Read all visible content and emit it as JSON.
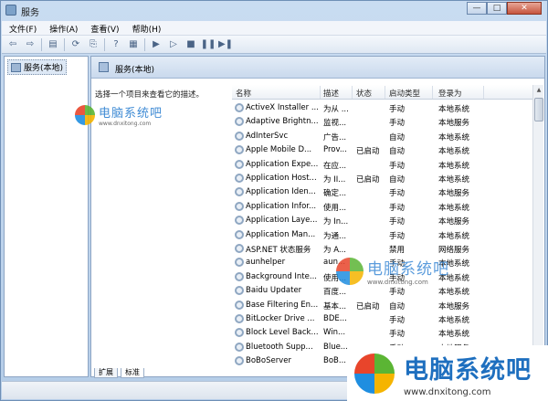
{
  "window": {
    "title": "服务",
    "minimize": "—",
    "maximize": "□",
    "close": "✕"
  },
  "menu": [
    "文件(F)",
    "操作(A)",
    "查看(V)",
    "帮助(H)"
  ],
  "tree": {
    "root_label": "服务(本地)"
  },
  "content": {
    "header_title": "服务(本地)",
    "description": "选择一个项目来查看它的描述。",
    "columns": [
      "名称",
      "描述",
      "状态",
      "启动类型",
      "登录为"
    ],
    "rows": [
      [
        "ActiveX Installer ...",
        "为从 ...",
        "",
        "手动",
        "本地系统"
      ],
      [
        "Adaptive Brightn...",
        "监视...",
        "",
        "手动",
        "本地服务"
      ],
      [
        "AdInterSvc",
        "广告...",
        "",
        "自动",
        "本地系统"
      ],
      [
        "Apple Mobile D...",
        "Prov...",
        "已启动",
        "自动",
        "本地系统"
      ],
      [
        "Application Expe...",
        "在应...",
        "",
        "手动",
        "本地系统"
      ],
      [
        "Application Host...",
        "为 II...",
        "已启动",
        "自动",
        "本地系统"
      ],
      [
        "Application Iden...",
        "确定...",
        "",
        "手动",
        "本地服务"
      ],
      [
        "Application Infor...",
        "使用...",
        "",
        "手动",
        "本地系统"
      ],
      [
        "Application Laye...",
        "为 In...",
        "",
        "手动",
        "本地服务"
      ],
      [
        "Application Man...",
        "为通...",
        "",
        "手动",
        "本地系统"
      ],
      [
        "ASP.NET 状态服务",
        "为 A...",
        "",
        "禁用",
        "网络服务"
      ],
      [
        "aunhelper",
        "aun...",
        "",
        "手动",
        "本地系统"
      ],
      [
        "Background Inte...",
        "使用...",
        "",
        "手动",
        "本地系统"
      ],
      [
        "Baidu Updater",
        "百度...",
        "",
        "手动",
        "本地系统"
      ],
      [
        "Base Filtering En...",
        "基本...",
        "已启动",
        "自动",
        "本地服务"
      ],
      [
        "BitLocker Drive ...",
        "BDE...",
        "",
        "手动",
        "本地系统"
      ],
      [
        "Block Level Back...",
        "Win...",
        "",
        "手动",
        "本地系统"
      ],
      [
        "Bluetooth Supp...",
        "Blue...",
        "",
        "手动",
        "本地服务"
      ],
      [
        "BoBoServer",
        "BoB...",
        "",
        "",
        ""
      ]
    ]
  },
  "tabs": [
    "扩展",
    "标准"
  ],
  "watermark": {
    "cn": "电脑系统吧",
    "en": "www.dnxitong.com"
  },
  "colors": {
    "logo_red": "#e8452b",
    "logo_green": "#5bb534",
    "logo_blue": "#1f8ee0",
    "logo_yellow": "#f5b400"
  }
}
